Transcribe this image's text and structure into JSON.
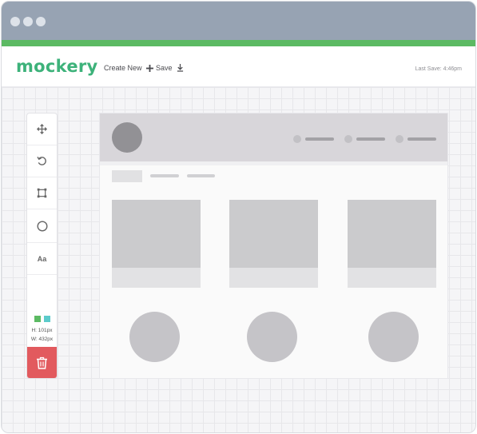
{
  "app": {
    "logo": "mockery",
    "menu": {
      "create_label": "Create New",
      "save_label": "Save"
    },
    "last_save": "Last Save: 4:46pm"
  },
  "toolbar": {
    "tools": [
      {
        "name": "move",
        "icon": "move-icon"
      },
      {
        "name": "undo",
        "icon": "undo-icon"
      },
      {
        "name": "rectangle",
        "icon": "rectangle-icon"
      },
      {
        "name": "circle",
        "icon": "circle-icon"
      },
      {
        "name": "text",
        "icon": "text-icon",
        "label": "Aa"
      }
    ],
    "swatches": [
      "#5cba63",
      "#5ccbcb"
    ],
    "height_label": "H: 101px",
    "width_label": "W: 432px"
  },
  "colors": {
    "accent": "#5cba63",
    "brand": "#3db27a",
    "danger": "#e25a5e",
    "titlebar": "#97a3b3"
  }
}
